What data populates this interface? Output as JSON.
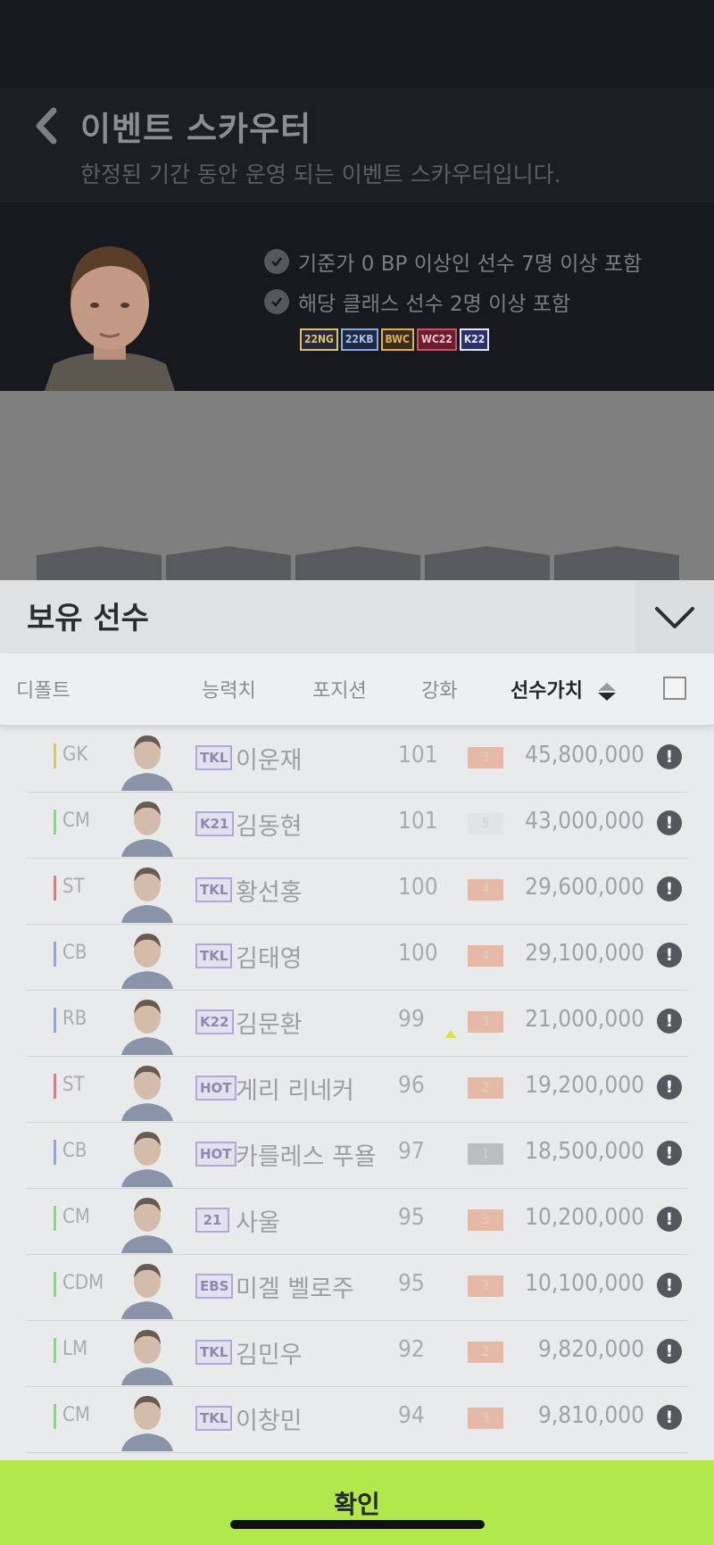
{
  "header": {
    "title": "이벤트 스카우터",
    "subtitle": "한정된 기간 동안 운영 되는 이벤트 스카우터입니다."
  },
  "requirements": [
    "기준가 0 BP 이상인 선수 7명 이상 포함",
    "해당 클래스 선수 2명 이상 포함"
  ],
  "class_badges": [
    {
      "label": "22NG",
      "color": "#d7c46b"
    },
    {
      "label": "22KB",
      "color": "#8aa8d8"
    },
    {
      "label": "BWC",
      "color": "#d8b452"
    },
    {
      "label": "WC22",
      "color": "#c4536a"
    },
    {
      "label": "K22",
      "color": "#e6e6f0"
    }
  ],
  "sheet": {
    "title": "보유 선수"
  },
  "columns": {
    "default": "디폴트",
    "ovr": "능력치",
    "position": "포지션",
    "upgrade": "강화",
    "value": "선수가치"
  },
  "players": [
    {
      "pos": "GK",
      "pos_color": "#d9c56a",
      "season": "TKL",
      "name": "이운재",
      "ovr": "101",
      "grade": "3",
      "grade_color": "#e5b9a6",
      "value": "45,800,000"
    },
    {
      "pos": "CM",
      "pos_color": "#8ed48a",
      "season": "K21",
      "name": "김동현",
      "ovr": "101",
      "grade": "5",
      "grade_color": "#e2e3e5",
      "value": "43,000,000"
    },
    {
      "pos": "ST",
      "pos_color": "#e07b80",
      "season": "TKL",
      "name": "황선홍",
      "ovr": "100",
      "grade": "4",
      "grade_color": "#e5b9a6",
      "value": "29,600,000"
    },
    {
      "pos": "CB",
      "pos_color": "#8fa6e0",
      "season": "TKL",
      "name": "김태영",
      "ovr": "100",
      "grade": "4",
      "grade_color": "#e5b9a6",
      "value": "29,100,000"
    },
    {
      "pos": "RB",
      "pos_color": "#8fa6e0",
      "season": "K22",
      "name": "김문환",
      "ovr": "99",
      "grade": "3",
      "grade_color": "#e5b9a6",
      "value": "21,000,000"
    },
    {
      "pos": "ST",
      "pos_color": "#e07b80",
      "season": "HOT",
      "name": "게리 리네커",
      "ovr": "96",
      "grade": "2",
      "grade_color": "#e5b9a6",
      "value": "19,200,000"
    },
    {
      "pos": "CB",
      "pos_color": "#8fa6e0",
      "season": "HOT",
      "name": "카를레스 푸욜",
      "ovr": "97",
      "grade": "1",
      "grade_color": "#bcbdbf",
      "value": "18,500,000"
    },
    {
      "pos": "CM",
      "pos_color": "#8ed48a",
      "season": "21",
      "name": "사울",
      "ovr": "95",
      "grade": "3",
      "grade_color": "#e5b9a6",
      "value": "10,200,000"
    },
    {
      "pos": "CDM",
      "pos_color": "#8ed48a",
      "season": "EBS",
      "name": "미겔 벨로주",
      "ovr": "95",
      "grade": "2",
      "grade_color": "#e5b9a6",
      "value": "10,100,000"
    },
    {
      "pos": "LM",
      "pos_color": "#8ed48a",
      "season": "TKL",
      "name": "김민우",
      "ovr": "92",
      "grade": "2",
      "grade_color": "#e5b9a6",
      "value": "9,820,000"
    },
    {
      "pos": "CM",
      "pos_color": "#8ed48a",
      "season": "TKL",
      "name": "이창민",
      "ovr": "94",
      "grade": "3",
      "grade_color": "#e5b9a6",
      "value": "9,810,000"
    }
  ],
  "confirm_label": "확인",
  "info_glyph": "!"
}
